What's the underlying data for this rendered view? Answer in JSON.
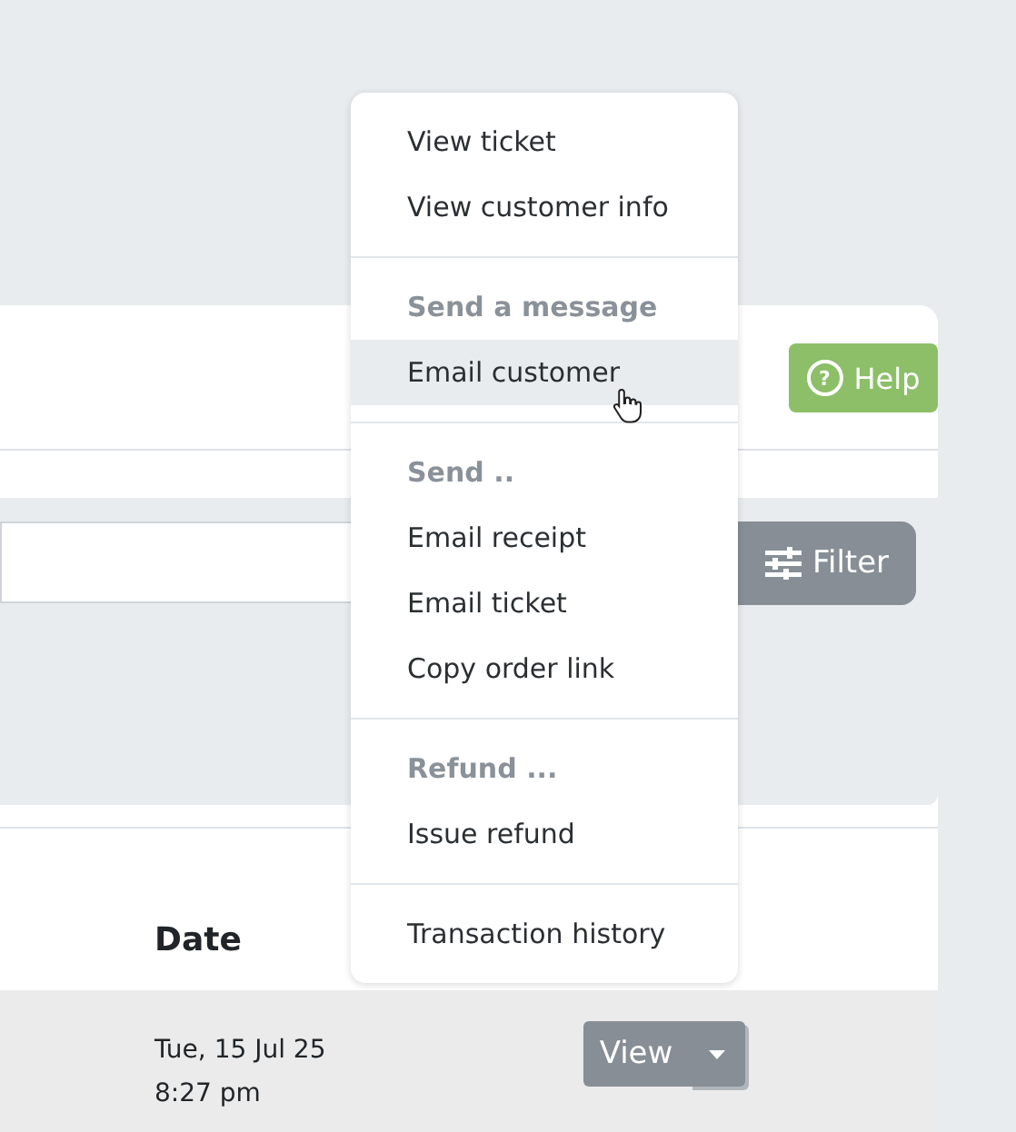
{
  "header": {
    "help_button": {
      "icon": "?",
      "label": "Help"
    }
  },
  "filter": {
    "filter_button": {
      "label": "Filter"
    }
  },
  "table": {
    "columns": [
      {
        "label": "Date"
      }
    ],
    "rows": [
      {
        "date": "Tue, 15 Jul 25",
        "time": "8:27 pm",
        "view_button": {
          "label": "View"
        }
      }
    ]
  },
  "dropdown_menu": {
    "groups": [
      {
        "items": [
          {
            "kind": "item",
            "label": "View ticket",
            "highlighted": false
          },
          {
            "kind": "item",
            "label": "View customer info",
            "highlighted": false
          }
        ]
      },
      {
        "items": [
          {
            "kind": "heading",
            "label": "Send a message",
            "highlighted": false
          },
          {
            "kind": "item",
            "label": "Email customer",
            "highlighted": true
          }
        ]
      },
      {
        "items": [
          {
            "kind": "heading",
            "label": "Send ..",
            "highlighted": false
          },
          {
            "kind": "item",
            "label": "Email receipt",
            "highlighted": false
          },
          {
            "kind": "item",
            "label": "Email ticket",
            "highlighted": false
          },
          {
            "kind": "item",
            "label": "Copy order link",
            "highlighted": false
          }
        ]
      },
      {
        "items": [
          {
            "kind": "heading",
            "label": "Refund ...",
            "highlighted": false
          },
          {
            "kind": "item",
            "label": "Issue refund",
            "highlighted": false
          }
        ]
      },
      {
        "items": [
          {
            "kind": "item",
            "label": "Transaction history",
            "highlighted": false
          }
        ]
      }
    ]
  }
}
